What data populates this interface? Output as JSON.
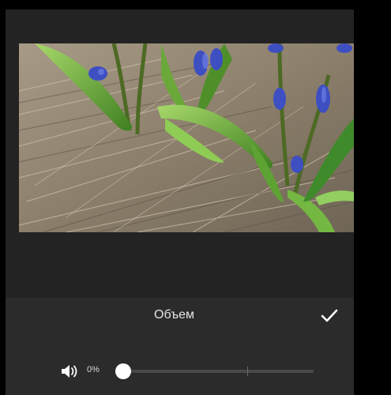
{
  "editor": {
    "panel_title": "Объем",
    "volume": {
      "value_text": "0%",
      "level": 0
    }
  },
  "colors": {
    "accent": "#ffffff",
    "panel": "#2b2b2b",
    "background": "#232323"
  },
  "icons": {
    "confirm": "checkmark-icon",
    "volume": "speaker-icon"
  }
}
